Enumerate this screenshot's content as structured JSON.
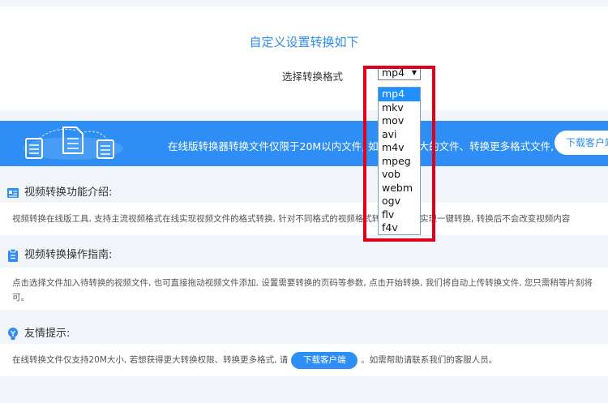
{
  "settings": {
    "title": "自定义设置转换如下",
    "format_label": "选择转换格式",
    "selected_format": "mp4",
    "options": [
      "mp4",
      "mkv",
      "mov",
      "avi",
      "m4v",
      "mpeg",
      "vob",
      "webm",
      "ogv",
      "flv",
      "f4v"
    ]
  },
  "banner": {
    "text": "在线版转换器转换文件仅限于20M以内文件, 如需转换更大的文件、转换更多格式文件, 请",
    "button_label": "下载客户端"
  },
  "intro": {
    "heading": "视频转换功能介绍:",
    "body": "视频转换在线版工具, 支持主流视频格式在线实现视频文件的格式转换, 针对不同格式的视频格式转换, 都可以实现一键转换, 转换后不会改变视频内容"
  },
  "guide": {
    "heading": "视频转换操作指南:",
    "body_line1": "点击选择文件加入待转换的视频文件, 也可直接拖动视频文件添加, 设置需要转换的页码等参数, 点击开始转换, 我们将自动上传转换文件, 您只需稍等片刻将",
    "body_line2": "可。"
  },
  "tips": {
    "heading": "友情提示:",
    "body_before": "在线转换文件仅支持20M大小, 若想获得更大转换权限、转换更多格式, 请",
    "button_label": "下载客户端",
    "body_after": "。如需帮助请联系我们的客服人员。"
  },
  "colors": {
    "accent": "#2f8ef5",
    "highlight": "#e0001b",
    "selected_option": "#1e90ff"
  }
}
